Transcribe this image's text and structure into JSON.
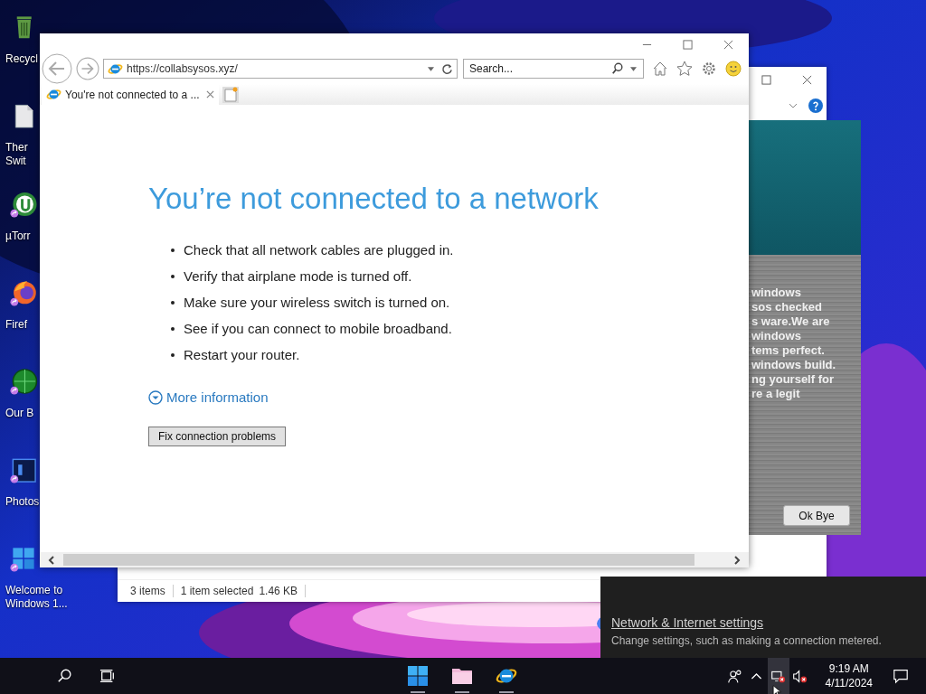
{
  "desktop_icons": [
    {
      "kind": "recycle-bin",
      "lines": [
        "Recycl"
      ],
      "shortcut": false
    },
    {
      "kind": "file",
      "lines": [
        "Ther",
        "Swit"
      ],
      "shortcut": false
    },
    {
      "kind": "torrent",
      "lines": [
        "µTorr"
      ],
      "shortcut": true
    },
    {
      "kind": "firefox",
      "lines": [
        "Firef"
      ],
      "shortcut": true
    },
    {
      "kind": "globe",
      "lines": [
        "Our B"
      ],
      "shortcut": true
    },
    {
      "kind": "photo-editor",
      "lines": [
        "Photos"
      ],
      "shortcut": true
    },
    {
      "kind": "windows",
      "lines": [
        "Welcome to",
        "Windows 1..."
      ],
      "shortcut": true
    }
  ],
  "background_window": {
    "status_items": [
      "3 items",
      "1 item selected",
      "1.46 KB"
    ]
  },
  "popup": {
    "message_lines": [
      "windows",
      "sos checked",
      "s ware.We are",
      "windows",
      "tems perfect.",
      "windows build.",
      "ng yourself for",
      "re a legit"
    ],
    "button": "Ok Bye"
  },
  "browser": {
    "url": "https://collabsysos.xyz/",
    "search_placeholder": "Search...",
    "tabs": [
      {
        "title": "You're not connected to a ...",
        "selected": true
      }
    ],
    "heading": "You’re not connected to a network",
    "bullets": [
      "Check that all network cables are plugged in.",
      "Verify that airplane mode is turned off.",
      "Make sure your wireless switch is turned on.",
      "See if you can connect to mobile broadband.",
      "Restart your router."
    ],
    "more_link": "More information",
    "fix_button": "Fix connection problems"
  },
  "network_flyout": {
    "link": "Network & Internet settings",
    "description": "Change settings, such as making a connection metered."
  },
  "taskbar": {
    "apps": [
      {
        "kind": "start"
      },
      {
        "kind": "folder"
      },
      {
        "kind": "browser"
      }
    ],
    "tray_icons": [
      {
        "kind": "people",
        "selected": false
      },
      {
        "kind": "chevron",
        "selected": false
      },
      {
        "kind": "network-offline",
        "selected": true
      },
      {
        "kind": "volume-muted",
        "selected": false
      }
    ],
    "time": "9:19 AM",
    "date": "4/11/2024"
  }
}
